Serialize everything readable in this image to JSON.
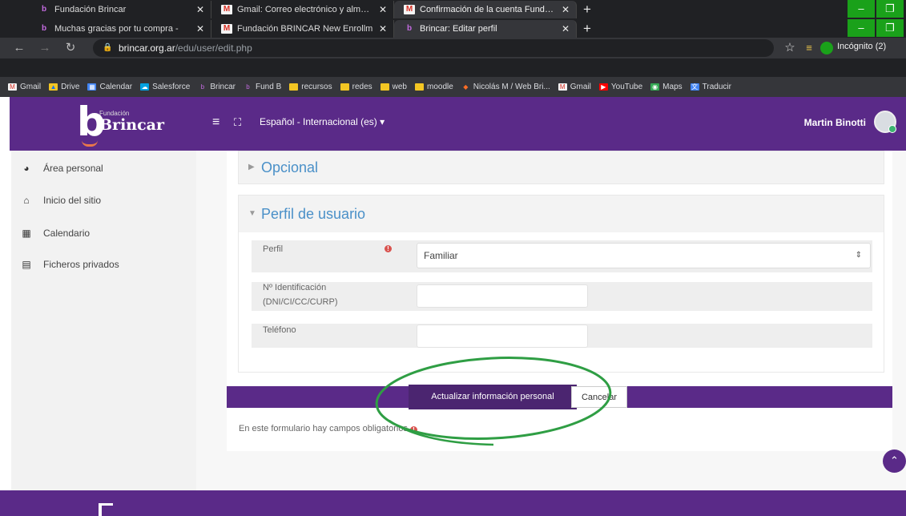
{
  "browser": {
    "tabs_row1": [
      {
        "title": "Fundación Brincar",
        "fav": "b",
        "active": false
      },
      {
        "title": "Gmail: Correo electrónico y almacenamiento",
        "fav": "m",
        "active": false
      },
      {
        "title": "Confirmación de la cuenta Fundación",
        "fav": "m",
        "active": true
      }
    ],
    "tabs_row2": [
      {
        "title": "Muchas gracias por tu compra - ",
        "fav": "b",
        "active": false
      },
      {
        "title": "Fundación BRINCAR New Enrollm",
        "fav": "m",
        "active": false
      },
      {
        "title": "Brincar: Editar perfil",
        "fav": "b",
        "active": true
      }
    ],
    "new_tab": "+",
    "close_glyph": "✕",
    "url_host": "brincar.org.ar",
    "url_path": "/edu/user/edit.php",
    "incognito_label": "Incógnito (2)",
    "bookmarks": [
      {
        "label": "Gmail",
        "icon": "gmail-icon"
      },
      {
        "label": "Drive",
        "icon": "drive-icon"
      },
      {
        "label": "Calendar",
        "icon": "calendar-icon"
      },
      {
        "label": "Salesforce",
        "icon": "salesforce-icon"
      },
      {
        "label": "Brincar",
        "icon": "brincar-icon"
      },
      {
        "label": "Fund B",
        "icon": "brincar-icon"
      },
      {
        "label": "recursos",
        "icon": "folder-icon"
      },
      {
        "label": "redes",
        "icon": "folder-icon"
      },
      {
        "label": "web",
        "icon": "folder-icon"
      },
      {
        "label": "moodle",
        "icon": "folder-icon"
      },
      {
        "label": "Nicolás M / Web Bri...",
        "icon": "gitlab-icon"
      },
      {
        "label": "Gmail",
        "icon": "gmail-icon"
      },
      {
        "label": "YouTube",
        "icon": "youtube-icon"
      },
      {
        "label": "Maps",
        "icon": "maps-icon"
      },
      {
        "label": "Traducir",
        "icon": "translate-icon"
      }
    ]
  },
  "header": {
    "logo_small": "Fundación",
    "logo_brand": "Brincar",
    "logo_mark": "b",
    "language": "Español - Internacional (es)",
    "language_caret": "▾",
    "user_name": "Martin Binotti"
  },
  "sidebar": {
    "items": [
      {
        "label": "Área personal",
        "icon": "dashboard-icon"
      },
      {
        "label": "Inicio del sitio",
        "icon": "home-icon"
      },
      {
        "label": "Calendario",
        "icon": "calendar-icon"
      },
      {
        "label": "Ficheros privados",
        "icon": "files-icon"
      }
    ]
  },
  "form": {
    "optional_title": "Opcional",
    "profile_title": "Perfil de usuario",
    "fields": {
      "perfil_label": "Perfil",
      "perfil_value": "Familiar",
      "id_label_line1": "Nº Identificación",
      "id_label_line2": "(DNI/CI/CC/CURP)",
      "id_value": "",
      "phone_label": "Teléfono",
      "phone_value": ""
    },
    "required_glyph": "!",
    "save_label": "Actualizar información personal",
    "cancel_label": "Cancelar",
    "required_note": "En este formulario hay campos obligatorios"
  },
  "colors": {
    "brand": "#5a2a88",
    "link": "#4a90c8",
    "required": "#d9534f",
    "annotation": "#2f9e44"
  }
}
